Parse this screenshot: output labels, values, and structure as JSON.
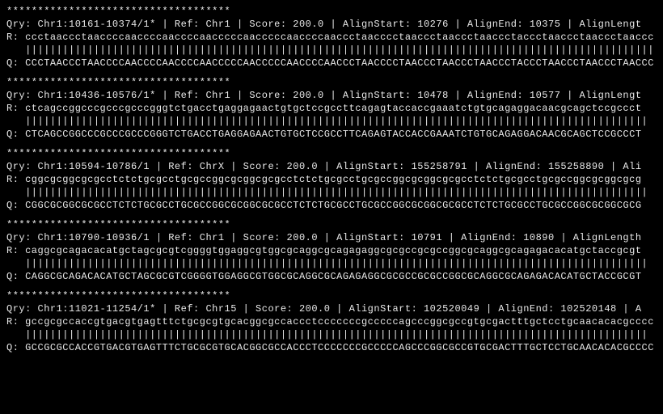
{
  "alignments": [
    {
      "stars": "************************************",
      "header": "Qry: Chr1:10161-10374/1* | Ref: Chr1 | Score: 200.0 | AlignStart: 10276 | AlignEnd: 10375 | AlignLengt",
      "ref": "R: ccctaaccctaaccccaaccccaaccccaacccccaacccccaaccccaaccctaacccctaaccctaaccctaaccctaccctaaccctaaccctaaccc",
      "mid": "   |||||||||||||||||||||||||||||||||||||||||||||||||||||||||||||||||||||||||||||||||||||||||||||||||||||",
      "qry": "Q: CCCTAACCCTAACCCCAACCCCAACCCCAACCCCCAACCCCCAACCCCAACCCTAACCCCTAACCCTAACCCTAACCCTACCCTAACCCTAACCCTAACCC"
    },
    {
      "stars": "************************************",
      "header": "Qry: Chr1:10436-10576/1* | Ref: Chr1 | Score: 200.0 | AlignStart: 10478 | AlignEnd: 10577 | AlignLengt",
      "ref": "R: ctcagccggcccgcccgcccgggtctgacctgaggagaactgtgctccgccttcagagtaccaccgaaatctgtgcagaggacaacgcagctccgccct",
      "mid": "   ||||||||||||||||||||||||||||||||||||||||||||||||||||||||||||||||||||||||||||||||||||||||||||||||||||",
      "qry": "Q: CTCAGCCGGCCCGCCCGCCCGGGTCTGACCTGAGGAGAACTGTGCTCCGCCTTCAGAGTACCACCGAAATCTGTGCAGAGGACAACGCAGCTCCGCCCT"
    },
    {
      "stars": "************************************",
      "header": "Qry: Chr1:10594-10786/1 | Ref: ChrX | Score: 200.0 | AlignStart: 155258791 | AlignEnd: 155258890 | Ali",
      "ref": "R: cggcgcggcgcgcctctctgcgcctgcgccggcgcggcgcgcctctctgcgcctgcgccggcgcggcgcgcctctctgcgcctgcgccggcgcggcgcg",
      "mid": "   ||||||||||||||||||||||||||||||||||||||||||||||||||||||||||||||||||||||||||||||||||||||||||||||||||||",
      "qry": "Q: CGGCGCGGCGCGCCTCTCTGCGCCTGCGCCGGCGCGGCGCGCCTCTCTGCGCCTGCGCCGGCGCGGCGCGCCTCTCTGCGCCTGCGCCGGCGCGGCGCG"
    },
    {
      "stars": "************************************",
      "header": "Qry: Chr1:10790-10936/1 | Ref: Chr1 | Score: 200.0 | AlignStart: 10791 | AlignEnd: 10890 | AlignLength",
      "ref": "R: caggcgcagacacatgctagcgcgtcggggtggaggcgtggcgcaggcgcagagaggcgcgccgcgccggcgcaggcgcagagacacatgctaccgcgt",
      "mid": "   ||||||||||||||||||||||||||||||||||||||||||||||||||||||||||||||||||||||||||||||||||||||||||||||||||||",
      "qry": "Q: CAGGCGCAGACACATGCTAGCGCGTCGGGGTGGAGGCGTGGCGCAGGCGCAGAGAGGCGCGCCGCGCCGGCGCAGGCGCAGAGACACATGCTACCGCGT"
    },
    {
      "stars": "************************************",
      "header": "Qry: Chr1:11021-11254/1* | Ref: Chr15 | Score: 200.0 | AlignStart: 102520049 | AlignEnd: 102520148 | A",
      "ref": "R: gccgcgccaccgtgacgtgagtttctgcgcgtgcacggcgccaccctcccccccgcccccagcccggcgccgtgcgactttgctcctgcaacacacgcccc",
      "mid": "   ||||||||||||||||||||||||||||||||||||||||||||||||||||||||||||||||||||||||||||||||||||||||||||||||||||",
      "qry": "Q: GCCGCGCCACCGTGACGTGAGTTTCTGCGCGTGCACGGCGCCACCCTCCCCCCCGCCCCCAGCCCGGCGCCGTGCGACTTTGCTCCTGCAACACACGCCCC"
    }
  ]
}
